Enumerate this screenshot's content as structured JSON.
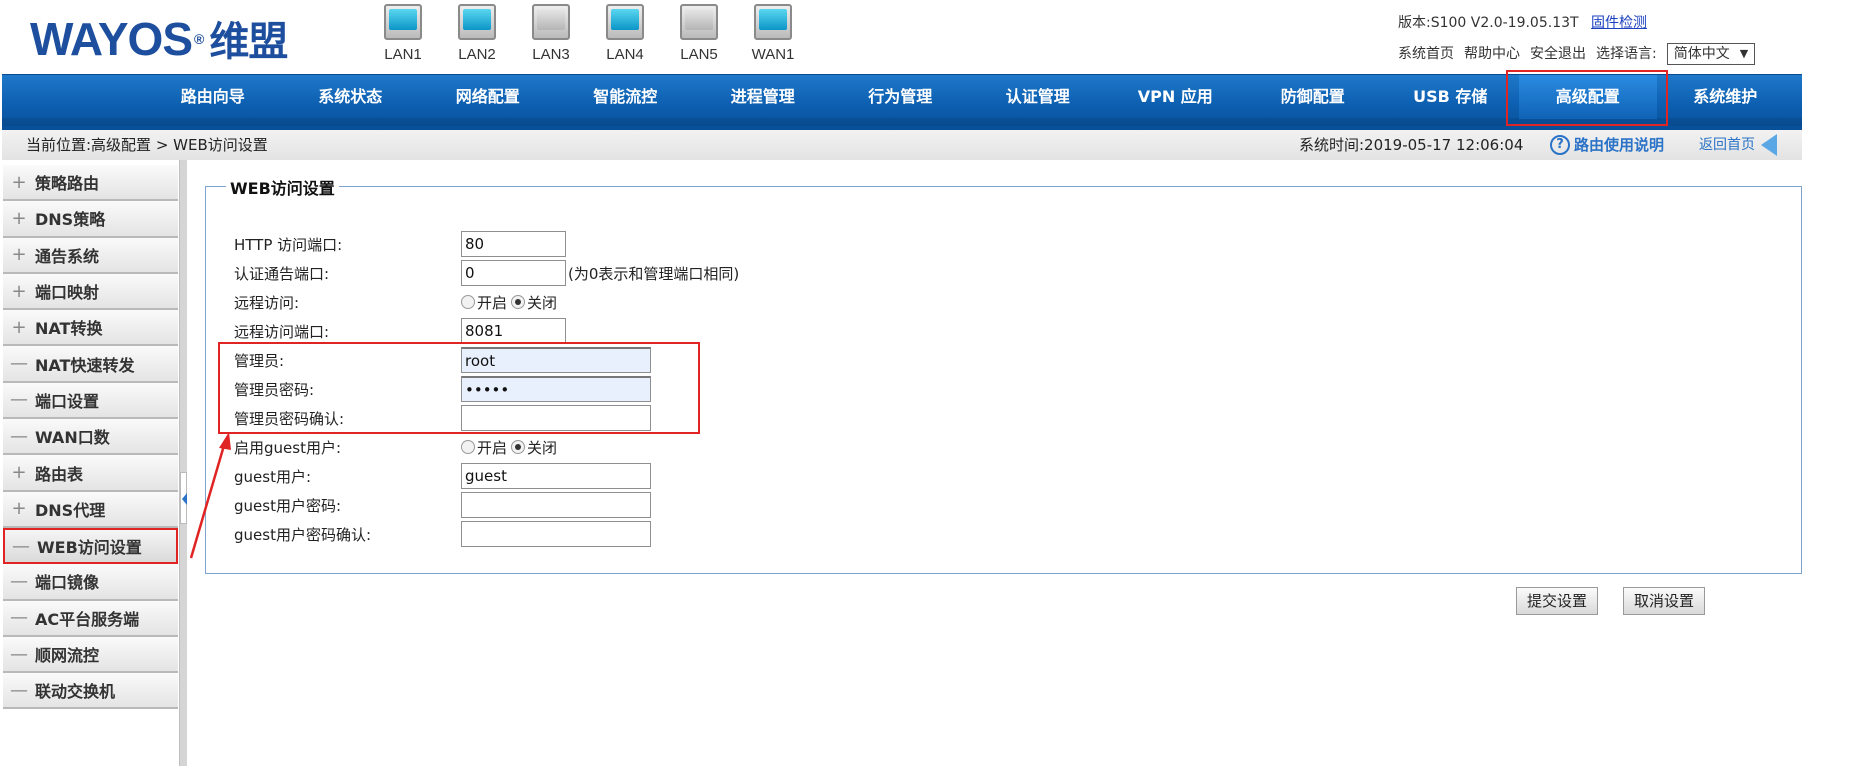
{
  "header": {
    "logo_text": "WAYOS",
    "logo_cn": "维盟",
    "logo_reg": "®",
    "version_label": "版本:S100 V2.0-19.05.13T",
    "firmware_check": "固件检测",
    "links": [
      "系统首页",
      "帮助中心",
      "安全退出"
    ],
    "lang_label": "选择语言:",
    "lang_value": "简体中文",
    "lang_caret": "▼",
    "ports": [
      {
        "label": "LAN1",
        "state": "on"
      },
      {
        "label": "LAN2",
        "state": "on"
      },
      {
        "label": "LAN3",
        "state": "off"
      },
      {
        "label": "LAN4",
        "state": "on"
      },
      {
        "label": "LAN5",
        "state": "off"
      },
      {
        "label": "WAN1",
        "state": "on"
      }
    ]
  },
  "nav": {
    "items": [
      "路由向导",
      "系统状态",
      "网络配置",
      "智能流控",
      "进程管理",
      "行为管理",
      "认证管理",
      "VPN 应用",
      "防御配置",
      "USB 存储",
      "高级配置",
      "系统维护"
    ],
    "active_index": 10
  },
  "breadcrumb": {
    "text": "当前位置:高级配置 > WEB访问设置",
    "system_time": "系统时间:2019-05-17 12:06:04",
    "help_icon": "?",
    "help_link": "路由使用说明",
    "home_link": "返回首页"
  },
  "sidebar": {
    "items": [
      {
        "label": "策略路由",
        "sym": "+"
      },
      {
        "label": "DNS策略",
        "sym": "+"
      },
      {
        "label": "通告系统",
        "sym": "+"
      },
      {
        "label": "端口映射",
        "sym": "+"
      },
      {
        "label": "NAT转换",
        "sym": "+"
      },
      {
        "label": "NAT快速转发",
        "sym": "—"
      },
      {
        "label": "端口设置",
        "sym": "—"
      },
      {
        "label": "WAN口数",
        "sym": "—"
      },
      {
        "label": "路由表",
        "sym": "+"
      },
      {
        "label": "DNS代理",
        "sym": "+"
      },
      {
        "label": "WEB访问设置",
        "sym": "—"
      },
      {
        "label": "端口镜像",
        "sym": "—"
      },
      {
        "label": "AC平台服务端",
        "sym": "—"
      },
      {
        "label": "顺网流控",
        "sym": "—"
      },
      {
        "label": "联动交换机",
        "sym": "—"
      }
    ],
    "active_index": 10
  },
  "form": {
    "legend": "WEB访问设置",
    "http_port_label": "HTTP 访问端口:",
    "http_port_value": "80",
    "auth_port_label": "认证通告端口:",
    "auth_port_value": "0",
    "auth_port_hint": "(为0表示和管理端口相同)",
    "remote_access_label": "远程访问:",
    "remote_on": "开启",
    "remote_off": "关闭",
    "remote_selected": "off",
    "remote_port_label": "远程访问端口:",
    "remote_port_value": "8081",
    "admin_label": "管理员:",
    "admin_value": "root",
    "admin_pwd_label": "管理员密码:",
    "admin_pwd_value": "•••••",
    "admin_pwd_confirm_label": "管理员密码确认:",
    "admin_pwd_confirm_value": "",
    "guest_enable_label": "启用guest用户:",
    "guest_on": "开启",
    "guest_off": "关闭",
    "guest_selected": "off",
    "guest_user_label": "guest用户:",
    "guest_user_value": "guest",
    "guest_pwd_label": "guest用户密码:",
    "guest_pwd_value": "",
    "guest_pwd_confirm_label": "guest用户密码确认:",
    "guest_pwd_confirm_value": ""
  },
  "buttons": {
    "submit": "提交设置",
    "cancel": "取消设置"
  },
  "colors": {
    "nav_blue": "#0d5fb0",
    "annotation_red": "#e02424",
    "link_blue": "#2a73c7"
  }
}
